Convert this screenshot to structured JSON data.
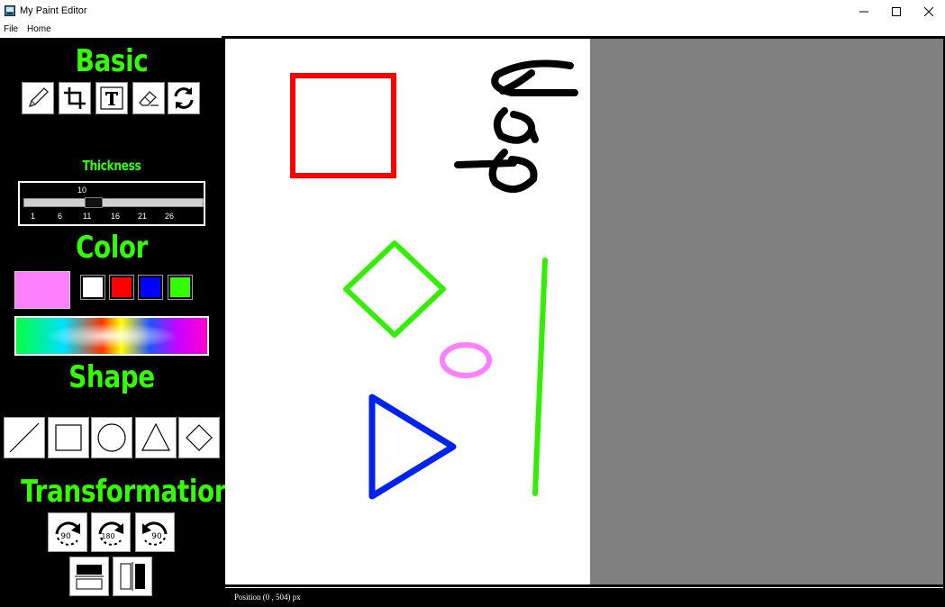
{
  "window": {
    "title": "My Paint Editor",
    "controls": [
      "minimize-icon",
      "maximize-icon",
      "close-icon"
    ]
  },
  "menu": {
    "items": [
      {
        "label": "File"
      },
      {
        "label": "Home"
      }
    ]
  },
  "sidebar": {
    "basic": {
      "title": "Basic",
      "tools": [
        {
          "name": "pencil",
          "icon": "pencil-icon"
        },
        {
          "name": "crop",
          "icon": "crop-icon"
        },
        {
          "name": "text",
          "icon": "text-icon"
        },
        {
          "name": "eraser",
          "icon": "eraser-icon"
        },
        {
          "name": "refresh",
          "icon": "refresh-icon"
        }
      ]
    },
    "thickness": {
      "title": "Thickness",
      "value": "10",
      "min": 1,
      "max": 30,
      "ticks": [
        "1",
        "6",
        "11",
        "16",
        "21",
        "26"
      ]
    },
    "color": {
      "title": "Color",
      "current": "#ff80ff",
      "swatches": [
        "#ffffff",
        "#ff0000",
        "#0000ff",
        "#33ff00"
      ],
      "palette": "color-spectrum"
    },
    "shape": {
      "title": "Shape",
      "tools": [
        {
          "name": "line",
          "icon": "line-icon"
        },
        {
          "name": "rectangle",
          "icon": "rectangle-icon"
        },
        {
          "name": "ellipse",
          "icon": "circle-icon"
        },
        {
          "name": "triangle",
          "icon": "triangle-icon"
        },
        {
          "name": "diamond",
          "icon": "diamond-icon"
        }
      ]
    },
    "transformation": {
      "title": "Transformation",
      "rotate": [
        {
          "label": "90",
          "icon": "rotate-right-90-icon"
        },
        {
          "label": "180",
          "icon": "rotate-180-icon"
        },
        {
          "label": "90",
          "icon": "rotate-left-90-icon"
        }
      ],
      "flip": [
        {
          "name": "flip-vertical",
          "icon": "flip-vertical-icon"
        },
        {
          "name": "flip-horizontal",
          "icon": "flip-horizontal-icon"
        }
      ]
    }
  },
  "canvas": {
    "drawing_colors": {
      "red": "#ff0000",
      "green": "#33ee00",
      "blue": "#0022ee",
      "pink": "#ff80ff",
      "black": "#000000"
    }
  },
  "status": {
    "text": "Position (0 , 504) px"
  }
}
